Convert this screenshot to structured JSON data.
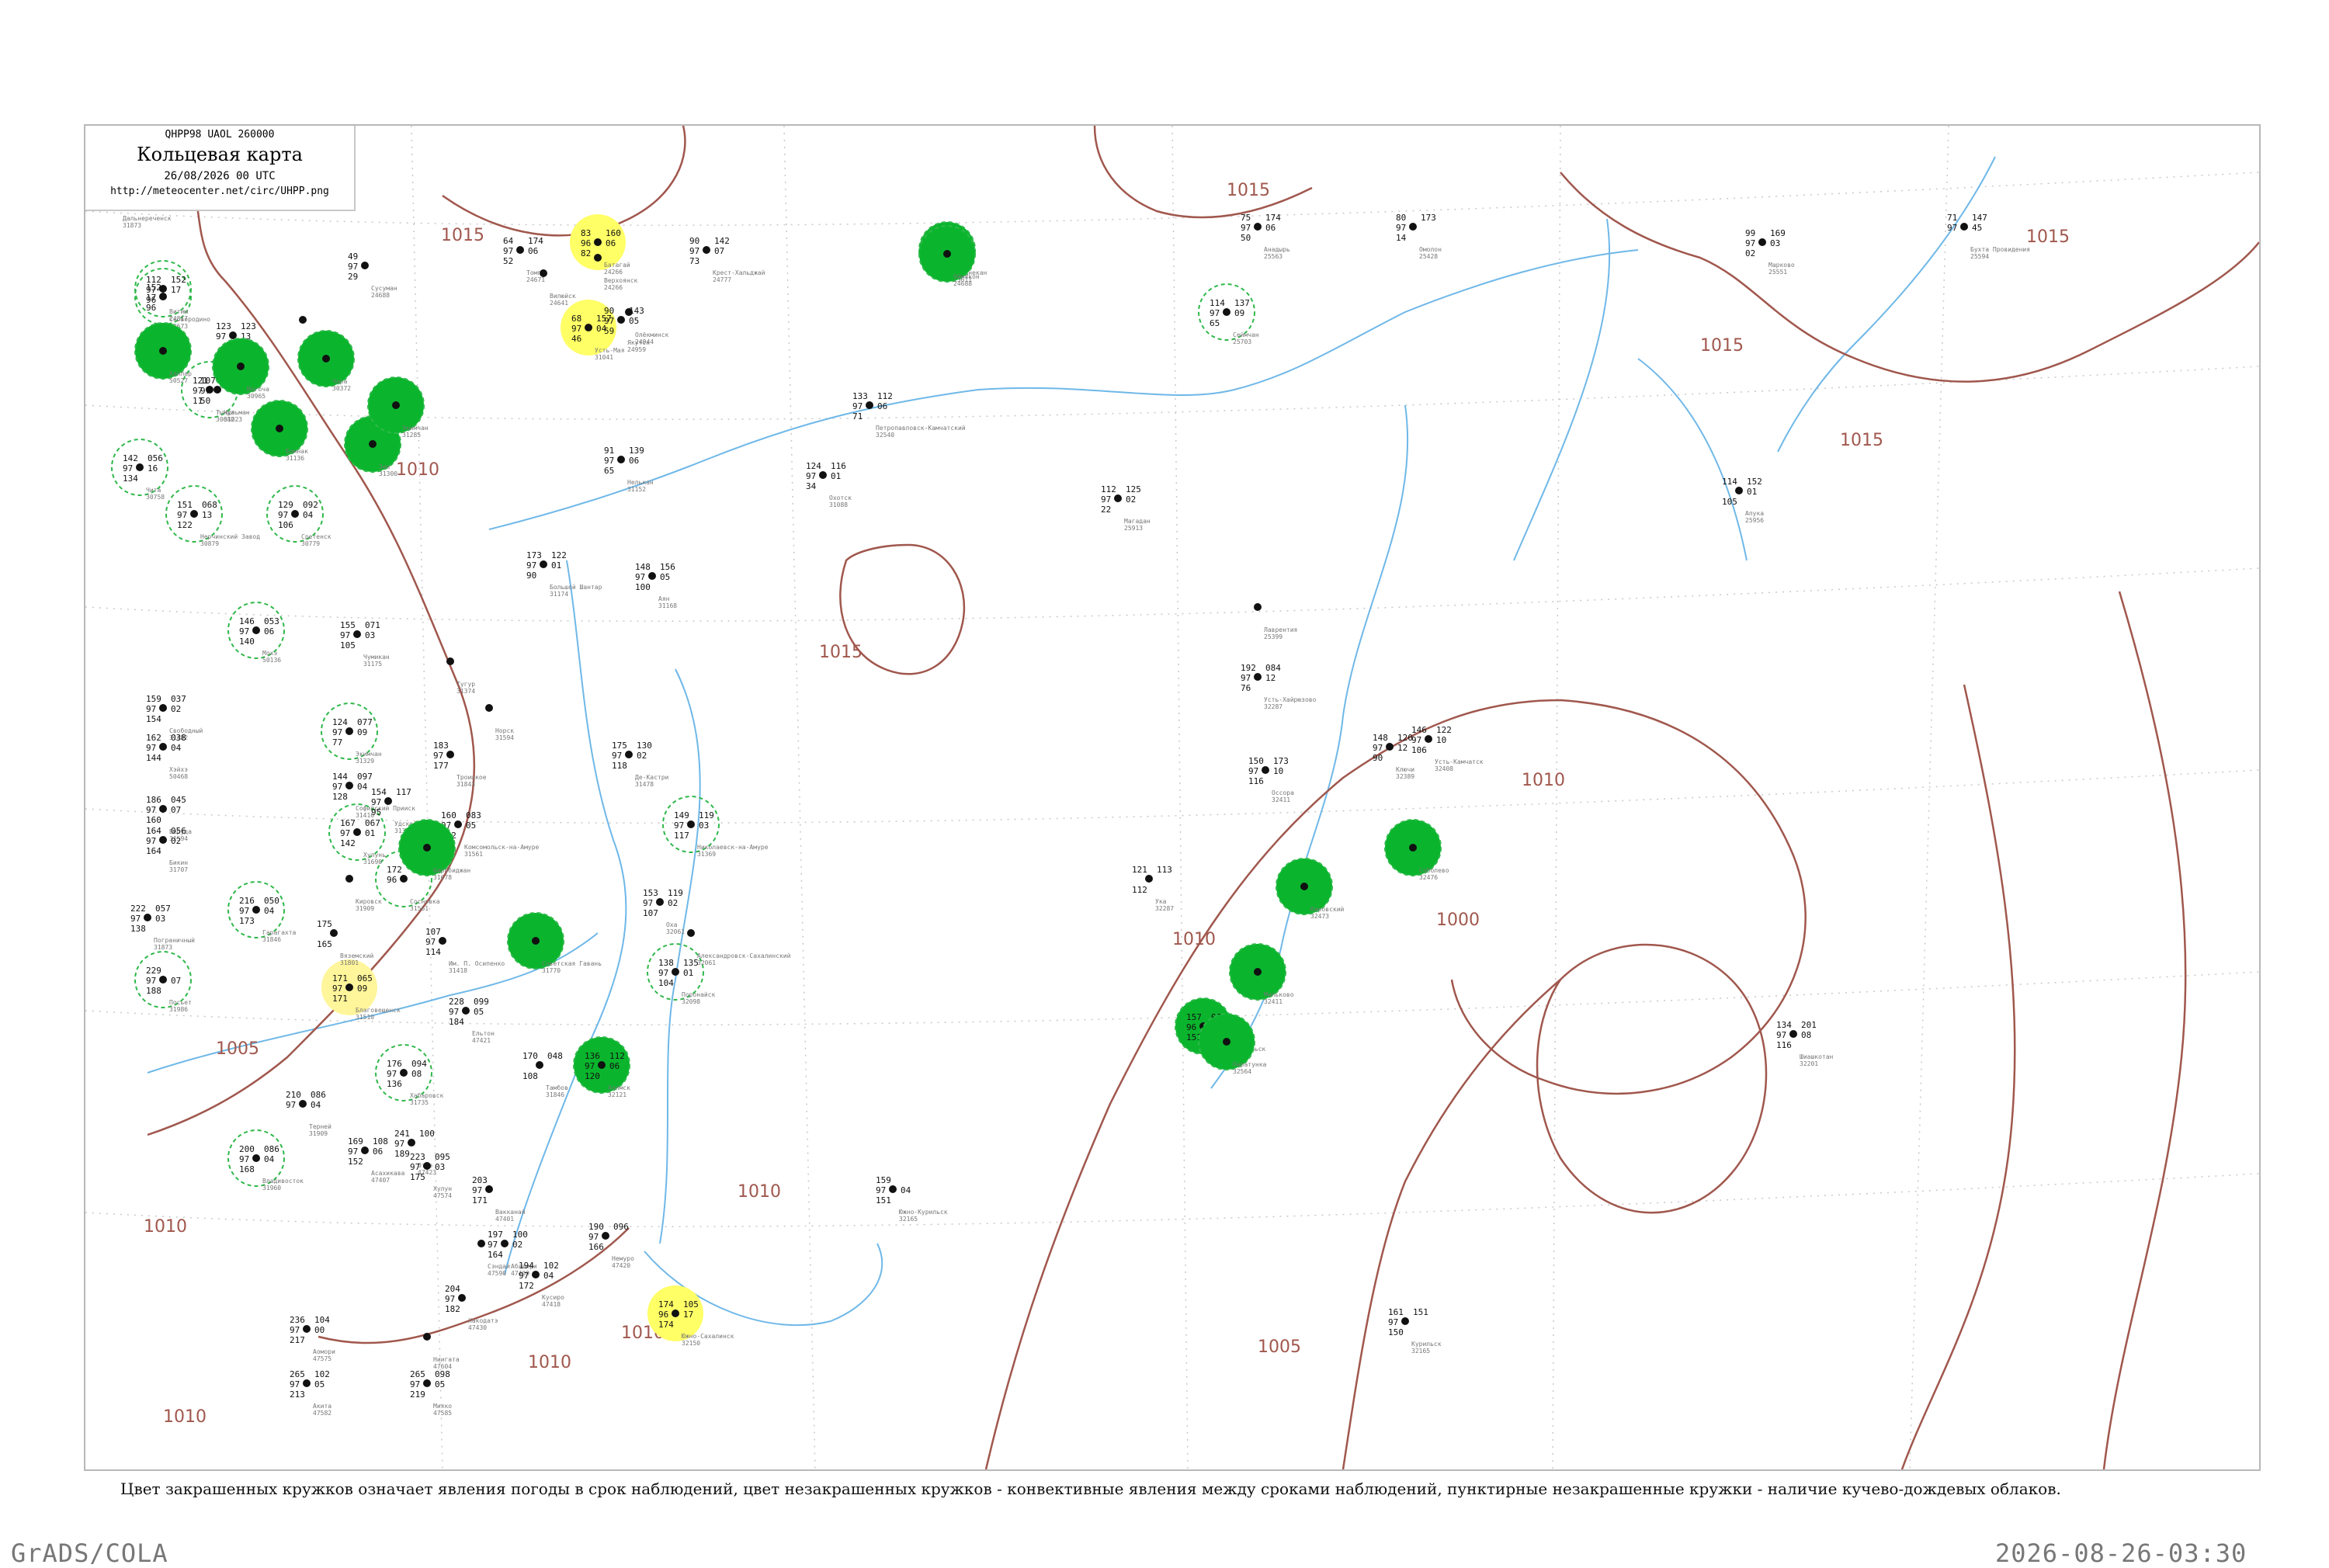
{
  "title": {
    "code": "QHPP98  UAOL  260000",
    "main": "Кольцевая карта",
    "date": "26/08/2026 00 UTC",
    "url": "http://meteocenter.net/circ/UHPP.png"
  },
  "legend_note": "Цвет закрашенных кружков означает явления погоды в срок наблюдений, цвет незакрашенных кружков - конвективные явления между сроками наблюдений, пунктирные незакрашенные кружки - наличие кучево-дождевых облаков.",
  "footer": {
    "left": "GrADS/COLA",
    "right": "2026-08-26-03:30"
  },
  "colors": {
    "isobar": "#a0574d",
    "coast": "#6fb8e8",
    "shower_green": "#0ab52d",
    "fog_yellow": "#ffff66",
    "light_yellow": "#fff59a",
    "dashed_green": "#2fb84a"
  },
  "isobar_labels": [
    "1015",
    "1015",
    "1015",
    "1015",
    "1015",
    "1015",
    "1010",
    "1010",
    "1010",
    "1010",
    "1010",
    "1010",
    "1010",
    "1005",
    "1005",
    "1000",
    "1010"
  ],
  "stations": [
    {
      "name": "Батагай",
      "id": "24266",
      "v": [
        "83",
        "96",
        "82",
        "160",
        "06"
      ],
      "marker": "fog"
    },
    {
      "name": "Усть-Мая",
      "id": "31041",
      "v": [
        "68",
        "97",
        "46",
        "157",
        "04"
      ],
      "marker": "fog"
    },
    {
      "name": "Охотск",
      "id": "31088",
      "v": [
        "124",
        "97",
        "34",
        "116",
        "01"
      ],
      "marker": "none"
    },
    {
      "name": "Аян",
      "id": "31168",
      "v": [
        "148",
        "97",
        "100",
        "156",
        "05"
      ],
      "marker": "none"
    },
    {
      "name": "Магадан",
      "id": "25913",
      "v": [
        "112",
        "97",
        "22",
        "125",
        "02"
      ],
      "marker": "none"
    },
    {
      "name": "Северо-Курильск",
      "id": "32215",
      "v": [
        "157",
        "96",
        "151",
        "060",
        "05"
      ],
      "marker": "shower"
    },
    {
      "name": "Петропавловск-Камчатский",
      "id": "32540",
      "v": [
        "133",
        "97",
        "71",
        "112",
        "06"
      ],
      "marker": "none"
    },
    {
      "name": "Усть-Камчатск",
      "id": "32408",
      "v": [
        "146",
        "97",
        "106",
        "122",
        "10"
      ],
      "marker": "none"
    },
    {
      "name": "Ключи",
      "id": "32389",
      "v": [
        "148",
        "97",
        "90",
        "120",
        "12"
      ],
      "marker": "none"
    },
    {
      "name": "Южно-Сахалинск",
      "id": "32150",
      "v": [
        "174",
        "96",
        "174",
        "105",
        "17"
      ],
      "marker": "fog"
    },
    {
      "name": "Хабаровск",
      "id": "31735",
      "v": [
        "176",
        "97",
        "136",
        "094",
        "08"
      ],
      "marker": "cb"
    },
    {
      "name": "Владивосток",
      "id": "31960",
      "v": [
        "200",
        "97",
        "168",
        "086",
        "04"
      ],
      "marker": "cb"
    },
    {
      "name": "Благовещенск",
      "id": "31510",
      "v": [
        "171",
        "97",
        "171",
        "065",
        "09"
      ],
      "marker": "light"
    },
    {
      "name": "Николаевск-на-Амуре",
      "id": "31369",
      "v": [
        "149",
        "97",
        "117",
        "119",
        "03"
      ],
      "marker": "cb"
    },
    {
      "name": "Оха",
      "id": "32061",
      "v": [
        "153",
        "97",
        "107",
        "119",
        "02"
      ],
      "marker": "none"
    },
    {
      "name": "Поронайск",
      "id": "32098",
      "v": [
        "138",
        "97",
        "104",
        "135",
        "01"
      ],
      "marker": "cb"
    },
    {
      "name": "Холмск",
      "id": "32121",
      "v": [
        "136",
        "97",
        "120",
        "112",
        "06"
      ],
      "marker": "shower"
    },
    {
      "name": "Курильск",
      "id": "32165",
      "v": [
        "161",
        "97",
        "150",
        "151",
        ""
      ],
      "marker": "none"
    },
    {
      "name": "Шиашкотан",
      "id": "32201",
      "v": [
        "134",
        "97",
        "116",
        "201",
        "08"
      ],
      "marker": "none"
    },
    {
      "name": "Анадырь",
      "id": "25563",
      "v": [
        "75",
        "97",
        "50",
        "174",
        "06"
      ],
      "marker": "none"
    },
    {
      "name": "Марково",
      "id": "25551",
      "v": [
        "99",
        "97",
        "02",
        "169",
        "03"
      ],
      "marker": "none"
    },
    {
      "name": "Омолон",
      "id": "25428",
      "v": [
        "80",
        "97",
        "14",
        "173",
        ""
      ],
      "marker": "none"
    },
    {
      "name": "Бухта Провидения",
      "id": "25594",
      "v": [
        "71",
        "97",
        "",
        "147",
        "45"
      ],
      "marker": "none"
    },
    {
      "name": "Апука",
      "id": "25956",
      "v": [
        "114",
        "",
        "105",
        "152",
        "01"
      ],
      "marker": "none"
    },
    {
      "name": "Сеймчан",
      "id": "25703",
      "v": [
        "114",
        "97",
        "65",
        "137",
        "09"
      ],
      "marker": "cb"
    },
    {
      "name": "Среднекан",
      "id": "25611",
      "v": [
        "",
        "",
        "",
        "",
        ""
      ],
      "marker": "shower"
    },
    {
      "name": "Усть-Хайрюзово",
      "id": "32287",
      "v": [
        "192",
        "97",
        "76",
        "084",
        "12"
      ],
      "marker": "none"
    },
    {
      "name": "Оссора",
      "id": "32411",
      "v": [
        "150",
        "97",
        "116",
        "173",
        "10"
      ],
      "marker": "none"
    },
    {
      "name": "Соболево",
      "id": "32476",
      "v": [
        "",
        "",
        "",
        "",
        ""
      ],
      "marker": "shower"
    },
    {
      "name": "Кировский",
      "id": "32473",
      "v": [
        "",
        "",
        "",
        "",
        ""
      ],
      "marker": "shower"
    },
    {
      "name": "Мильково",
      "id": "32411",
      "v": [
        "",
        "",
        "",
        "",
        ""
      ],
      "marker": "shower"
    },
    {
      "name": "Паратунка",
      "id": "32564",
      "v": [
        "",
        "",
        "",
        "",
        ""
      ],
      "marker": "shower"
    },
    {
      "name": "Сковородино",
      "id": "30673",
      "v": [
        "152",
        "17",
        "96",
        "",
        ""
      ],
      "marker": "cb"
    },
    {
      "name": "Зея",
      "id": "31300",
      "v": [
        "",
        "",
        "",
        "",
        ""
      ],
      "marker": "shower"
    },
    {
      "name": "Бомнак",
      "id": "31136",
      "v": [
        "",
        "",
        "",
        "",
        ""
      ],
      "marker": "shower"
    },
    {
      "name": "Тында",
      "id": "30682",
      "v": [
        "121",
        "97",
        "11",
        "120",
        ""
      ],
      "marker": "cb"
    },
    {
      "name": "Чульман",
      "id": "31023",
      "v": [
        "107",
        "97",
        "50",
        "150",
        ""
      ],
      "marker": "none"
    },
    {
      "name": "Якутск",
      "id": "24959",
      "v": [
        "90",
        "97",
        "59",
        "143",
        "05"
      ],
      "marker": "none"
    },
    {
      "name": "Оймякон",
      "id": "24688",
      "v": [
        "",
        "",
        "",
        "",
        ""
      ],
      "marker": "shower"
    },
    {
      "name": "Экимчан",
      "id": "31285",
      "v": [
        "",
        "",
        "",
        "",
        ""
      ],
      "marker": "shower"
    },
    {
      "name": "Нелькан",
      "id": "31152",
      "v": [
        "91",
        "97",
        "65",
        "139",
        "06"
      ],
      "marker": "none"
    },
    {
      "name": "Большой Шантар",
      "id": "31174",
      "v": [
        "173",
        "97",
        "90",
        "122",
        "01"
      ],
      "marker": "none"
    },
    {
      "name": "Чумикан",
      "id": "31175",
      "v": [
        "155",
        "97",
        "105",
        "071",
        "03"
      ],
      "marker": "none"
    },
    {
      "name": "Экимчан",
      "id": "31329",
      "v": [
        "124",
        "97",
        "77",
        "077",
        "09"
      ],
      "marker": "cb"
    },
    {
      "name": "Софийский Прииск",
      "id": "31416",
      "v": [
        "144",
        "97",
        "128",
        "097",
        "04"
      ],
      "marker": "none"
    },
    {
      "name": "Комсомольск-на-Амуре",
      "id": "31561",
      "v": [
        "160",
        "97",
        "122",
        "083",
        "05"
      ],
      "marker": "none"
    },
    {
      "name": "Де-Кастри",
      "id": "31478",
      "v": [
        "175",
        "97",
        "118",
        "130",
        "02"
      ],
      "marker": "none"
    },
    {
      "name": "Александровск-Сахалинский",
      "id": "32061",
      "v": [
        "",
        "",
        "",
        "",
        ""
      ],
      "marker": "none"
    },
    {
      "name": "Советская Гавань",
      "id": "31770",
      "v": [
        "",
        "",
        "",
        "",
        ""
      ],
      "marker": "shower"
    },
    {
      "name": "Терней",
      "id": "31909",
      "v": [
        "210",
        "97",
        "",
        "086",
        "04"
      ],
      "marker": "none"
    },
    {
      "name": "Вакканай",
      "id": "47401",
      "v": [
        "203",
        "97",
        "171",
        "",
        ""
      ],
      "marker": "none"
    },
    {
      "name": "Абашири",
      "id": "47409",
      "v": [
        "197",
        "97",
        "164",
        "100",
        "02"
      ],
      "marker": "none"
    },
    {
      "name": "Немуро",
      "id": "47420",
      "v": [
        "190",
        "97",
        "166",
        "096",
        ""
      ],
      "marker": "none"
    },
    {
      "name": "Кусиро",
      "id": "47418",
      "v": [
        "194",
        "97",
        "172",
        "102",
        "04"
      ],
      "marker": "none"
    },
    {
      "name": "Хакодатэ",
      "id": "47430",
      "v": [
        "204",
        "97",
        "182",
        "",
        ""
      ],
      "marker": "none"
    },
    {
      "name": "Аомори",
      "id": "47575",
      "v": [
        "236",
        "97",
        "217",
        "104",
        "00"
      ],
      "marker": "none"
    },
    {
      "name": "Акита",
      "id": "47582",
      "v": [
        "265",
        "97",
        "213",
        "102",
        "05"
      ],
      "marker": "none"
    },
    {
      "name": "Мияко",
      "id": "47585",
      "v": [
        "265",
        "97",
        "219",
        "098",
        "05"
      ],
      "marker": "none"
    },
    {
      "name": "Сэндай",
      "id": "47590",
      "v": [
        "",
        "",
        "",
        "",
        ""
      ],
      "marker": "none"
    },
    {
      "name": "Ниигата",
      "id": "47604",
      "v": [
        "",
        "",
        "",
        "",
        ""
      ],
      "marker": "none"
    },
    {
      "name": "Сусуман",
      "id": "24688",
      "v": [
        "49",
        "97",
        "29",
        "",
        ""
      ],
      "marker": "none"
    },
    {
      "name": "Томпо",
      "id": "24671",
      "v": [
        "64",
        "97",
        "52",
        "174",
        "06"
      ],
      "marker": "none"
    },
    {
      "name": "Верхоянск",
      "id": "24266",
      "v": [
        "",
        "",
        "",
        "",
        ""
      ],
      "marker": "none"
    },
    {
      "name": "Крест-Хальджай",
      "id": "24777",
      "v": [
        "90",
        "97",
        "73",
        "142",
        "07"
      ],
      "marker": "none"
    },
    {
      "name": "Южно-Курильск",
      "id": "32165",
      "v": [
        "159",
        "97",
        "151",
        "",
        "04"
      ],
      "marker": "none"
    },
    {
      "name": "Вилюйск",
      "id": "24641",
      "v": [
        "",
        "",
        "",
        "",
        ""
      ],
      "marker": "none"
    },
    {
      "name": "Олёкминск",
      "id": "24944",
      "v": [
        "",
        "",
        "",
        "",
        ""
      ],
      "marker": "none"
    },
    {
      "name": "Алдан",
      "id": "31004",
      "v": [
        "",
        "",
        "",
        "",
        ""
      ],
      "marker": "none"
    },
    {
      "name": "Витим",
      "id": "24817",
      "v": [
        "112",
        "97",
        "96",
        "152",
        "17"
      ],
      "marker": "cb"
    },
    {
      "name": "Бодайбо",
      "id": "30372",
      "v": [
        "123",
        "97",
        "",
        "123",
        "13"
      ],
      "marker": "none"
    },
    {
      "name": "Чара",
      "id": "30372",
      "v": [
        "",
        "",
        "",
        "",
        ""
      ],
      "marker": "shower"
    },
    {
      "name": "Могоча",
      "id": "30965",
      "v": [
        "",
        "",
        "",
        "",
        ""
      ],
      "marker": "shower"
    },
    {
      "name": "Чита",
      "id": "30758",
      "v": [
        "142",
        "97",
        "134",
        "056",
        "16"
      ],
      "marker": "cb"
    },
    {
      "name": "Нерчинский Завод",
      "id": "30879",
      "v": [
        "151",
        "97",
        "122",
        "068",
        "13"
      ],
      "marker": "cb"
    },
    {
      "name": "Сретенск",
      "id": "30779",
      "v": [
        "129",
        "97",
        "106",
        "092",
        "04"
      ],
      "marker": "cb"
    },
    {
      "name": "Хайлар",
      "id": "50527",
      "v": [
        "",
        "",
        "",
        "",
        ""
      ],
      "marker": "shower"
    },
    {
      "name": "Мохэ",
      "id": "50136",
      "v": [
        "146",
        "97",
        "140",
        "053",
        "06"
      ],
      "marker": "cb"
    },
    {
      "name": "Свободный",
      "id": "31482",
      "v": [
        "159",
        "97",
        "154",
        "037",
        "02"
      ],
      "marker": "none"
    },
    {
      "name": "Хэйхэ",
      "id": "50468",
      "v": [
        "162",
        "97",
        "144",
        "038",
        "04"
      ],
      "marker": "none"
    },
    {
      "name": "Беруда",
      "id": "31594",
      "v": [
        "186",
        "97",
        "160",
        "045",
        "07"
      ],
      "marker": "none"
    },
    {
      "name": "Бикин",
      "id": "31707",
      "v": [
        "164",
        "97",
        "164",
        "056",
        "02"
      ],
      "marker": "none"
    },
    {
      "name": "Пограничный",
      "id": "31873",
      "v": [
        "222",
        "97",
        "138",
        "057",
        "03"
      ],
      "marker": "none"
    },
    {
      "name": "Посьет",
      "id": "31986",
      "v": [
        "229",
        "97",
        "188",
        "",
        "07"
      ],
      "marker": "cb"
    },
    {
      "name": "Гарагахта",
      "id": "31846",
      "v": [
        "216",
        "97",
        "173",
        "050",
        "04"
      ],
      "marker": "cb"
    },
    {
      "name": "Дальнереченск",
      "id": "31873",
      "v": [
        "",
        "",
        "",
        "089",
        "01"
      ],
      "marker": "none"
    },
    {
      "name": "Вяземский",
      "id": "31801",
      "v": [
        "175",
        "",
        "165",
        "",
        ""
      ],
      "marker": "none"
    },
    {
      "name": "Им. П. Осипенко",
      "id": "31418",
      "v": [
        "107",
        "97",
        "114",
        "",
        ""
      ],
      "marker": "none"
    },
    {
      "name": "Троицкое",
      "id": "31843",
      "v": [
        "183",
        "97",
        "177",
        "",
        ""
      ],
      "marker": "none"
    },
    {
      "name": "Сосновка",
      "id": "31561",
      "v": [
        "172",
        "96",
        "",
        "060",
        ""
      ],
      "marker": "cb"
    },
    {
      "name": "Хулунь",
      "id": "31690",
      "v": [
        "167",
        "97",
        "142",
        "067",
        "01"
      ],
      "marker": "cb"
    },
    {
      "name": "Удское",
      "id": "31379",
      "v": [
        "154",
        "97",
        "95",
        "117",
        ""
      ],
      "marker": "none"
    },
    {
      "name": "Тугур",
      "id": "31374",
      "v": [
        "",
        "",
        "",
        "",
        ""
      ],
      "marker": "none"
    },
    {
      "name": "Норск",
      "id": "31594",
      "v": [
        "",
        "",
        "",
        "",
        ""
      ],
      "marker": "none"
    },
    {
      "name": "Кировск",
      "id": "31909",
      "v": [
        "",
        "",
        "",
        "",
        ""
      ],
      "marker": "none"
    },
    {
      "name": "Биробиджан",
      "id": "31678",
      "v": [
        "",
        "",
        "",
        "",
        ""
      ],
      "marker": "shower"
    },
    {
      "name": "Ельтон",
      "id": "47421",
      "v": [
        "228",
        "97",
        "184",
        "099",
        "05"
      ],
      "marker": "none"
    },
    {
      "name": "Оттэ",
      "id": "47423",
      "v": [
        "241",
        "97",
        "189",
        "100",
        ""
      ],
      "marker": "none"
    },
    {
      "name": "Хулун",
      "id": "47574",
      "v": [
        "223",
        "97",
        "175",
        "095",
        "03"
      ],
      "marker": "none"
    },
    {
      "name": "Асахикава",
      "id": "47407",
      "v": [
        "169",
        "97",
        "152",
        "108",
        "06"
      ],
      "marker": "none"
    },
    {
      "name": "Тамбов",
      "id": "31846",
      "v": [
        "170",
        "",
        "108",
        "048",
        ""
      ],
      "marker": "none"
    },
    {
      "name": "Ука",
      "id": "32287",
      "v": [
        "121",
        "",
        "112",
        "113",
        ""
      ],
      "marker": "none"
    },
    {
      "name": "Лаврентия",
      "id": "25399",
      "v": [
        "",
        "",
        "",
        "",
        ""
      ],
      "marker": "none"
    }
  ]
}
